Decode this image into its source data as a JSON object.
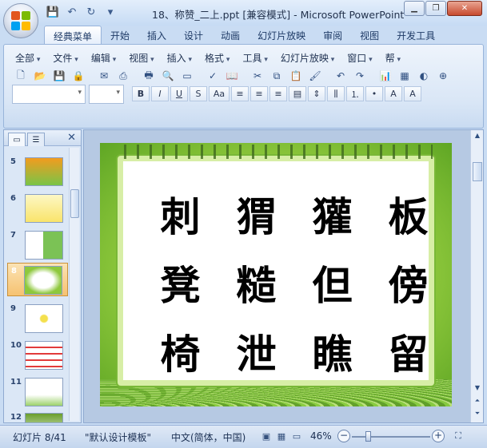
{
  "window": {
    "title": "18、称赞_二上.ppt [兼容模式] - Microsoft PowerPoint",
    "controls": [
      "minimize",
      "restore",
      "close"
    ]
  },
  "quick_access": [
    "save-icon",
    "undo-icon",
    "redo-icon",
    "customize-icon"
  ],
  "tabs": [
    "经典菜单",
    "开始",
    "插入",
    "设计",
    "动画",
    "幻灯片放映",
    "审阅",
    "视图",
    "开发工具"
  ],
  "active_tab": "经典菜单",
  "menus": [
    "全部",
    "文件",
    "编辑",
    "视图",
    "插入",
    "格式",
    "工具",
    "幻灯片放映",
    "窗口",
    "帮"
  ],
  "format_buttons": [
    "B",
    "I",
    "U",
    "S",
    "Aa"
  ],
  "thumbnails": [
    {
      "num": "5"
    },
    {
      "num": "6"
    },
    {
      "num": "7"
    },
    {
      "num": "8"
    },
    {
      "num": "9"
    },
    {
      "num": "10"
    },
    {
      "num": "11"
    },
    {
      "num": "12"
    }
  ],
  "selected_slide": "8",
  "slide": {
    "characters": [
      "刺",
      "猬",
      "獾",
      "板",
      "凳",
      "糙",
      "但",
      "傍",
      "椅",
      "泄",
      "瞧",
      "留"
    ]
  },
  "status": {
    "slide_info": "幻灯片 8/41",
    "template": "\"默认设计模板\"",
    "language": "中文(简体，中国)",
    "zoom": "46%"
  }
}
